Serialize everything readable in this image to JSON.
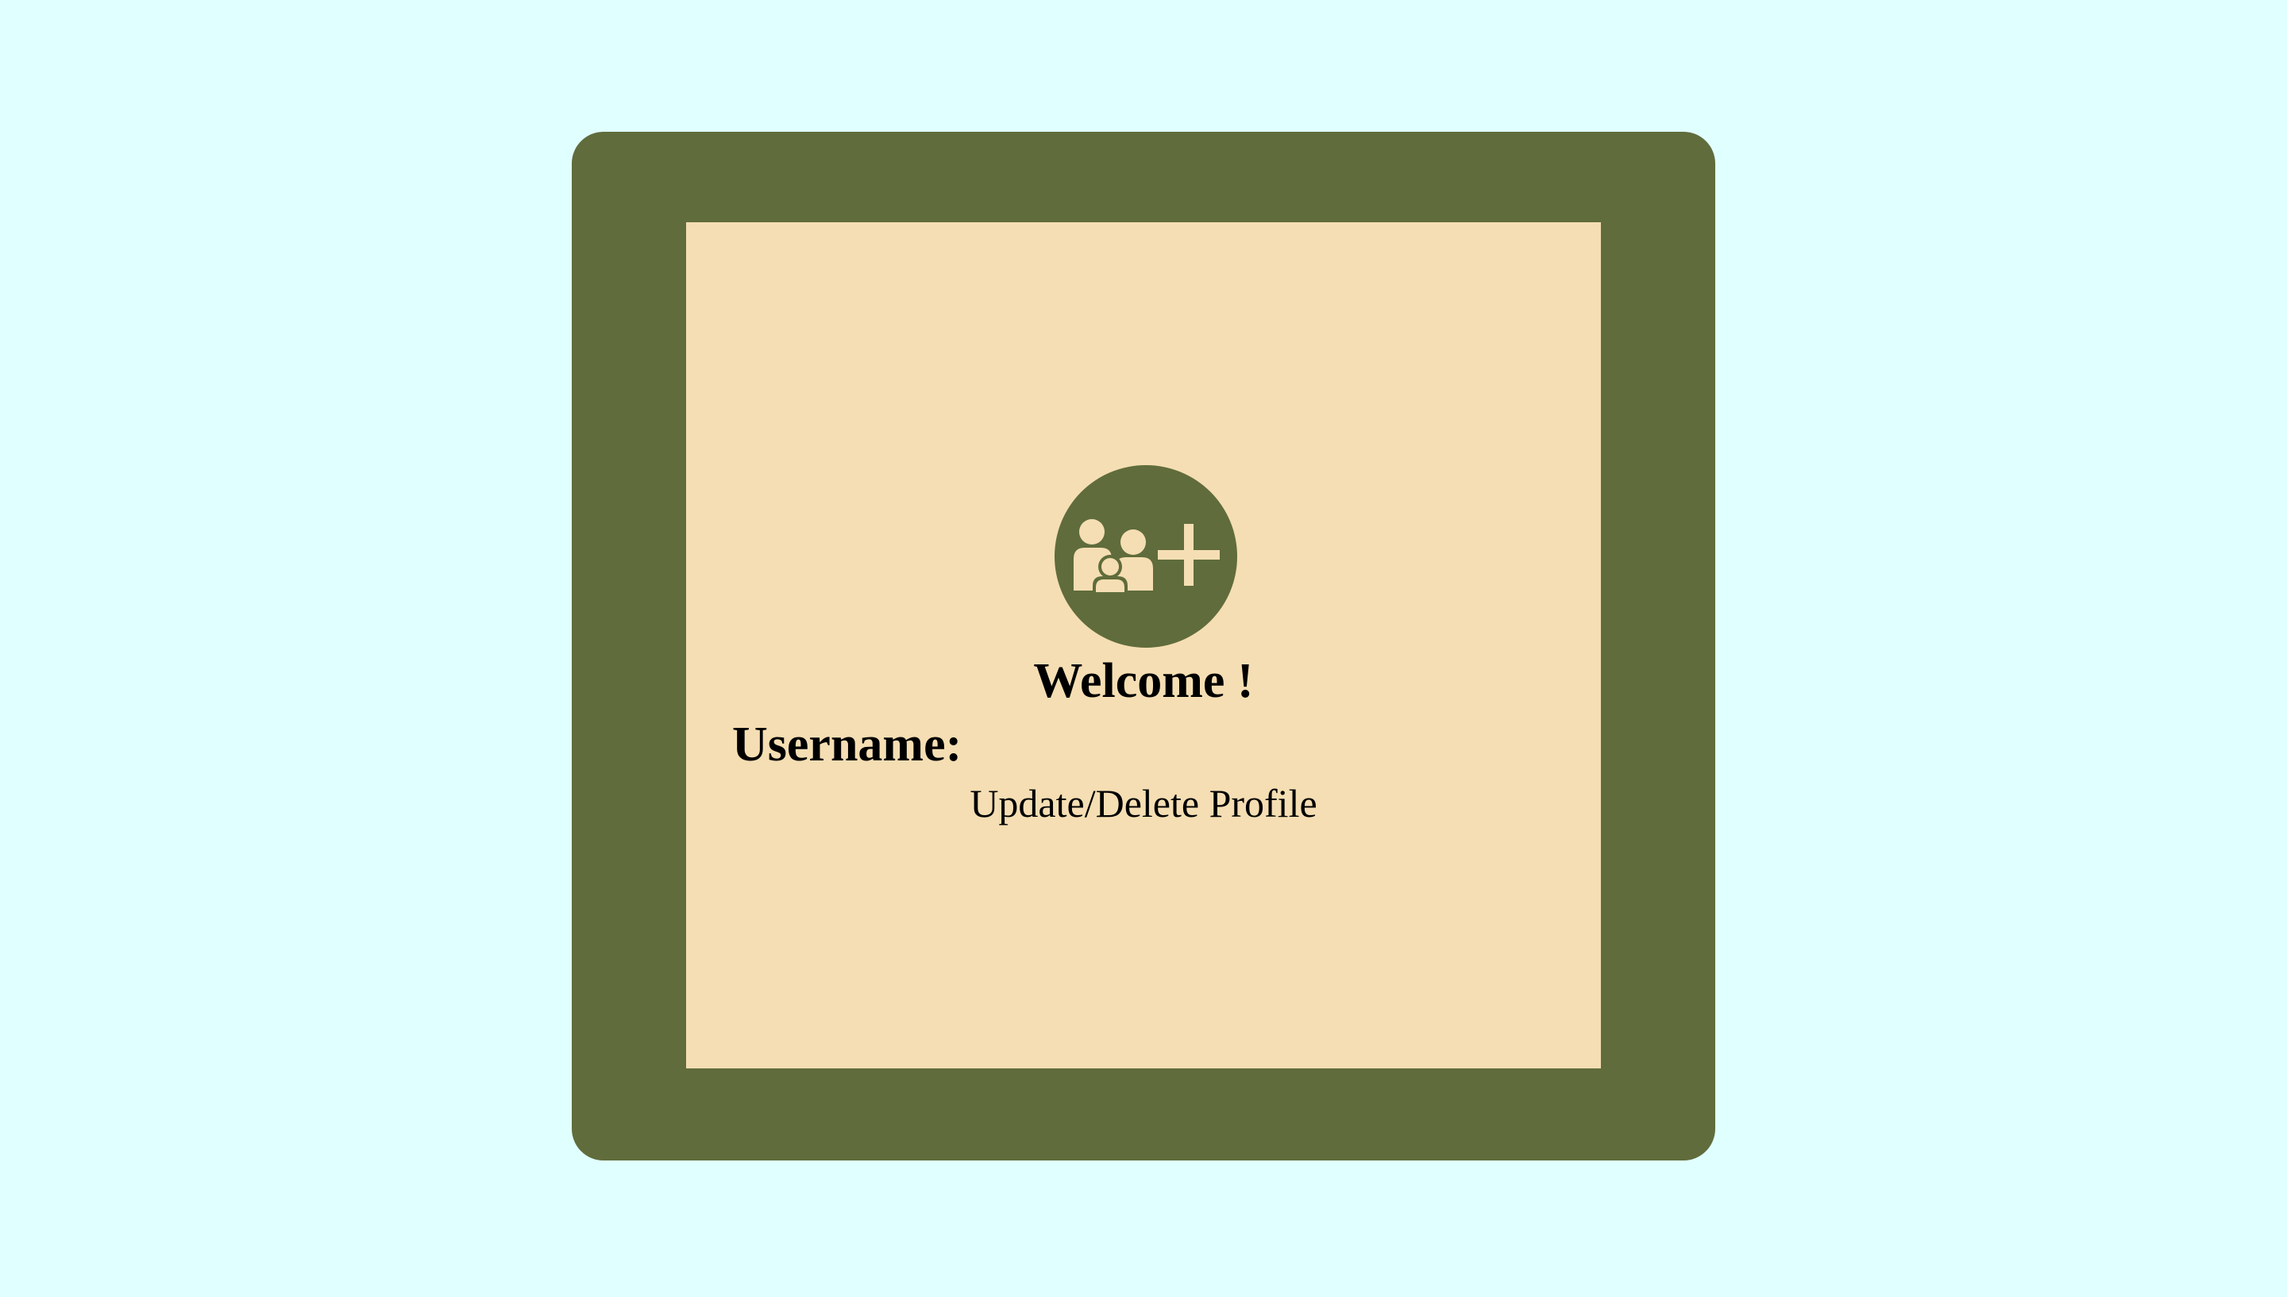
{
  "colors": {
    "background": "#e0ffff",
    "frame": "#606c3c",
    "panel": "#f5deb3",
    "icon_fill": "#f5deb3"
  },
  "avatar": {
    "icon": "family-add-icon"
  },
  "welcome": {
    "title": "Welcome !"
  },
  "profile": {
    "username_label": "Username:",
    "update_link": "Update/Delete Profile"
  }
}
